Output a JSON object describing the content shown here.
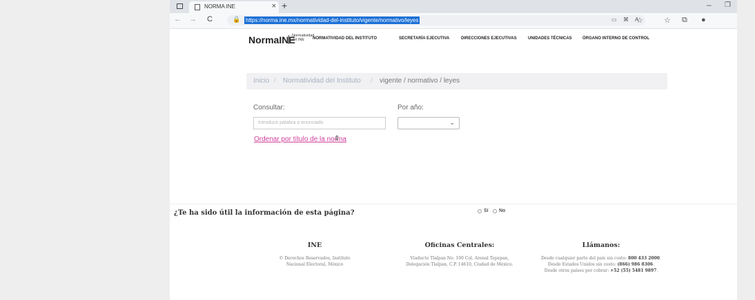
{
  "browser": {
    "tab_title": "NORMA INE",
    "tab_close": "×",
    "new_tab": "+",
    "url": "https://norma.ine.mx/normatividad-del-instituto/vigente/normativo/leyes",
    "back": "←",
    "forward": "→",
    "reload": "C",
    "lock": "🔒",
    "minimize": "–",
    "maximize": "❐"
  },
  "site": {
    "logo": "NormaINE",
    "logo_sub_1": "Normatividad",
    "logo_sub_2": "del INE",
    "menu": [
      "NORMATIVIDAD DEL INSTITUTO",
      "SECRETARÍA EJECUTIVA",
      "DIRECCIONES EJECUTIVAS",
      "UNIDADES TÉCNICAS",
      "ÓRGANO INTERNO DE CONTROL"
    ]
  },
  "breadcrumb": {
    "home": "Inicio",
    "sep": "/",
    "section": "Normatividad del Instituto",
    "current": "vigente / normativo / leyes"
  },
  "filters": {
    "search_label": "Consultar:",
    "search_placeholder": "Introducir palabra o enunciado",
    "year_label": "Por año:",
    "year_value": "",
    "sort_link": "Ordenar por título de la norma",
    "sort_icon": "⇕"
  },
  "feedback": {
    "question": "¿Te ha sido útil la información de esta página?",
    "yes": "Sí",
    "no": "No"
  },
  "footer": {
    "col1_title": "INE",
    "col1_line1": "© Derechos Reservados, Instituto",
    "col1_line2": "Nacional Electoral, México",
    "col2_title": "Oficinas Centrales:",
    "col2_line1": "Viaducto Tlalpan No. 100 Col. Arenal Tepepan,",
    "col2_line2": "Delegación Tlalpan, C.P. 14610, Ciudad de México.",
    "col3_title": "Llámanos:",
    "col3_line1_text": "Desde cualquier parte del país sin costo: ",
    "col3_line1_num": "800 433 2000",
    "col3_line2_text": "Desde Estados Unidos sin costo: ",
    "col3_line2_num": "(866) 986 8306",
    "col3_line3_text": "Desde otros países por cobrar: ",
    "col3_line3_num": "+52 (55) 5481 9897"
  }
}
